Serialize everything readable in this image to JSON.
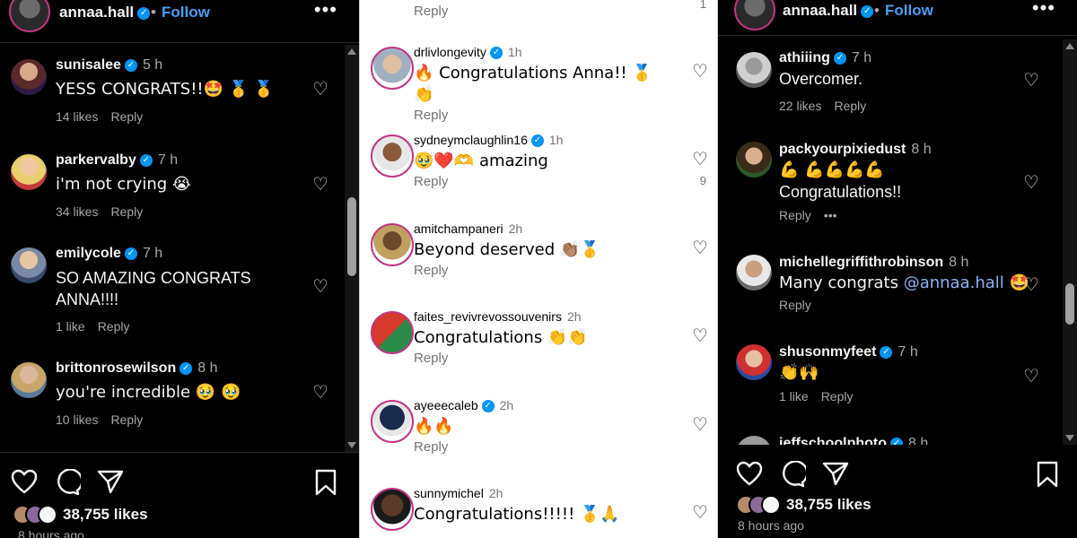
{
  "left": {
    "header": {
      "username": "annaa.hall",
      "dot": "•",
      "follow": "Follow",
      "more": "•••"
    },
    "comments": [
      {
        "user": "sunisalee",
        "time": "5 h",
        "text": "YESS CONGRATS!!🤩 🥇 🥇",
        "likes": "14 likes",
        "reply": "Reply"
      },
      {
        "user": "parkervalby",
        "time": "7 h",
        "text": "i'm not crying 😭",
        "likes": "34 likes",
        "reply": "Reply"
      },
      {
        "user": "emilycole",
        "time": "7 h",
        "text": "SO AMAZING CONGRATS ANNA!!!!",
        "likes": "1 like",
        "reply": "Reply"
      },
      {
        "user": "brittonrosewilson",
        "time": "8 h",
        "text": "you're incredible 🥹 🥹",
        "likes": "10 likes",
        "reply": "Reply"
      }
    ],
    "footer": {
      "likes": "38,755 likes",
      "time_ago": "8 hours ago"
    }
  },
  "middle": {
    "top_reply": "Reply",
    "top_count": "1",
    "comments": [
      {
        "user": "drlivlongevity",
        "time": "1h",
        "text": "🔥 Congratulations Anna!! 🥇👏",
        "reply": "Reply"
      },
      {
        "user": "sydneymclaughlin16",
        "time": "1h",
        "text": "🥹❤️🫶 amazing",
        "reply": "Reply",
        "heart_count": "9"
      },
      {
        "user": "amitchampaneri",
        "time": "2h",
        "text": "Beyond deserved 👏🏽🥇",
        "reply": "Reply"
      },
      {
        "user": "faites_revivrevossouvenirs",
        "time": "2h",
        "text": "Congratulations 👏👏",
        "reply": "Reply"
      },
      {
        "user": "ayeeecaleb",
        "time": "2h",
        "text": "🔥🔥",
        "reply": "Reply"
      },
      {
        "user": "sunnymichel",
        "time": "2h",
        "text": "Congratulations!!!!! 🥇🙏",
        "reply": "Reply"
      }
    ]
  },
  "right": {
    "header": {
      "username": "annaa.hall",
      "dot": "•",
      "follow": "Follow",
      "more": "•••"
    },
    "comments": [
      {
        "user": "athiiing",
        "time": "7 h",
        "text": "Overcomer.",
        "likes": "22 likes",
        "reply": "Reply"
      },
      {
        "user": "packyourpixiedust",
        "time": "8 h",
        "text_line1": "💪 💪💪💪💪",
        "text": "Congratulations!!",
        "reply": "Reply",
        "more": "•••"
      },
      {
        "user": "michellegriffithrobinson",
        "time": "8 h",
        "text": "Many congrats",
        "mention": "@annaa.hall",
        "emoji": "🤩",
        "reply": "Reply"
      },
      {
        "user": "shusonmyfeet",
        "time": "7 h",
        "text": "👏🙌",
        "likes": "1 like",
        "reply": "Reply"
      },
      {
        "user": "jeffschoolphoto",
        "time": "8 h"
      }
    ],
    "footer": {
      "likes": "38,755 likes",
      "time_ago": "8 hours ago"
    }
  },
  "colors": {
    "accent": "#0095f6",
    "follow": "#4a9df8",
    "story_ring": "#c13584"
  },
  "icons": [
    "heart-icon",
    "comment-icon",
    "share-icon",
    "bookmark-icon",
    "verified-icon",
    "more-icon"
  ]
}
